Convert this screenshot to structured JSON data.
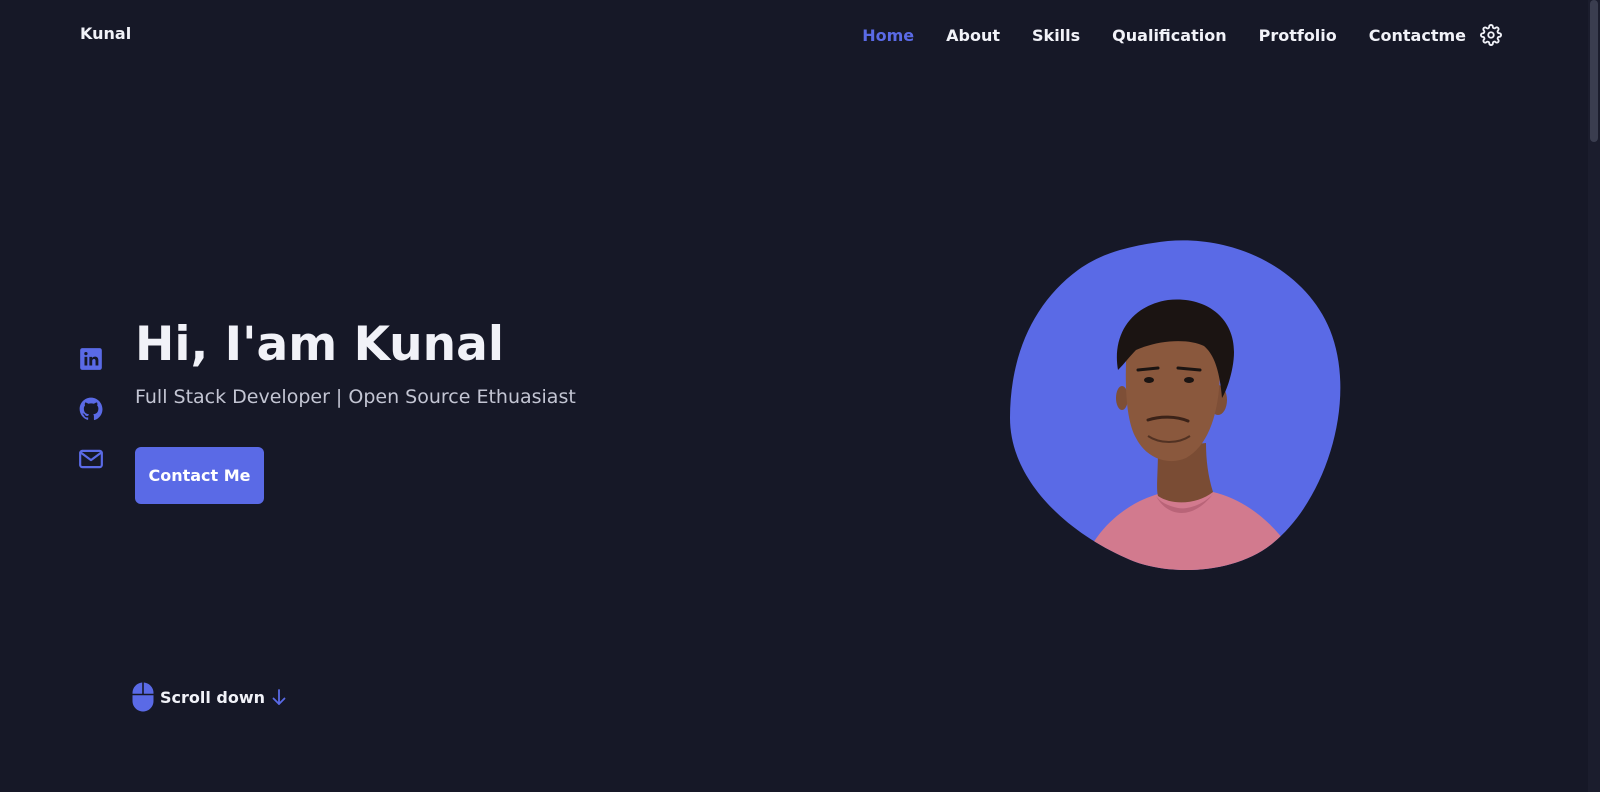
{
  "header": {
    "brand": "Kunal",
    "nav": [
      "Home",
      "About",
      "Skills",
      "Qualification",
      "Protfolio",
      "Contactme"
    ],
    "active_nav": "Home",
    "theme_icon": "gear-icon"
  },
  "hero": {
    "title": "Hi, I'am Kunal",
    "subtitle": "Full Stack Developer | Open Source Ethuasiast",
    "cta_label": "Contact Me",
    "scroll_label": "Scroll down",
    "avatar_icon": "profile-photo"
  },
  "social": [
    "linkedin-icon",
    "github-icon",
    "mail-icon"
  ],
  "colors": {
    "background": "#161827",
    "accent": "#5a6ae6",
    "text": "#f1f2f8",
    "subtext": "#c3c5d3"
  }
}
